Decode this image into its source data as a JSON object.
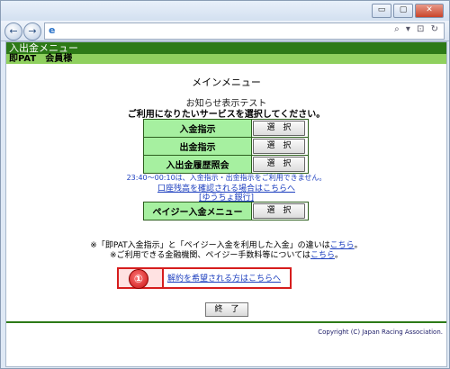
{
  "browser": {
    "window_buttons": {
      "minimize": "▭",
      "maximize": "▢",
      "close": "✕"
    },
    "nav": {
      "back": "←",
      "forward": "→"
    },
    "address": {
      "icon": "e",
      "tools": "⌕ ▾ ⊡ ↻"
    }
  },
  "header": {
    "title": "入出金メニュー",
    "user": "即PAT　会員様"
  },
  "main": {
    "title": "メインメニュー",
    "notice": "お知らせ表示テスト",
    "prompt": "ご利用になりたいサービスを選択してください。",
    "menu": [
      {
        "label": "入金指示",
        "button": "選　択"
      },
      {
        "label": "出金指示",
        "button": "選　択"
      },
      {
        "label": "入出金履歴照会",
        "button": "選　択"
      }
    ],
    "warning": "23:40～00:10は、入金指示・出金指示をご利用できません。",
    "balance_link": "口座残高を確認される場合はこちらへ",
    "bank_link": "[ゆうちょ銀行]",
    "payeasy": {
      "label": "ペイジー入金メニュー",
      "button": "選　択"
    },
    "info1_text": "※「即PAT入金指示」と「ペイジー入金を利用した入金」の違いは",
    "info1_link": "こちら",
    "info1_end": "。",
    "info2_text": "※ご利用できる金融機関、ペイジー手数料等については",
    "info2_link": "こちら",
    "info2_end": "。",
    "callout": {
      "badge": "①",
      "link": "解約を希望される方はこちらへ"
    },
    "end_button": "終　了",
    "copyright": "Copyright (C) Japan Racing Association."
  }
}
